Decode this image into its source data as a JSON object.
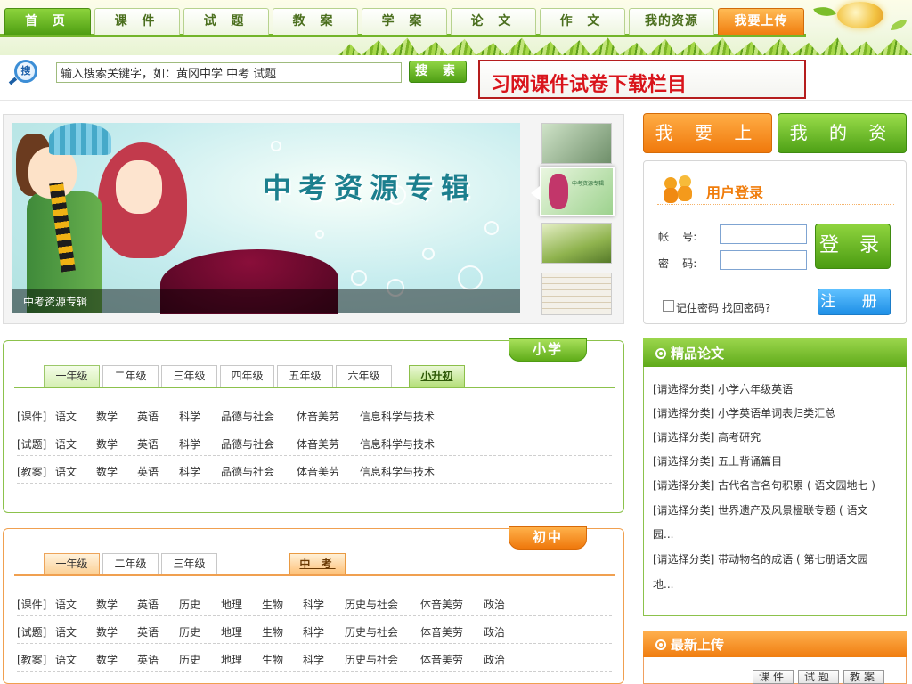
{
  "nav": {
    "items": [
      "首 页",
      "课 件",
      "试 题",
      "教 案",
      "学 案",
      "论 文",
      "作 文",
      "我的资源",
      "我要上传"
    ]
  },
  "search": {
    "icon_text": "搜",
    "value": "输入搜索关键字，如：黄冈中学 中考 试题",
    "button": "搜 索",
    "promo": "习网课件试卷下载栏目"
  },
  "banner": {
    "title": "中考资源专辑",
    "caption": "中考资源专辑",
    "thumb_labels": [
      "中考资源专辑"
    ]
  },
  "user": {
    "upload_label": "我 要 上 传",
    "myres_label": "我 的 资 源",
    "login_title": "用户登录",
    "account_label": "帐    号:",
    "password_label": "密    码:",
    "login_button": "登 录",
    "remember_label": "记住密码 找回密码?",
    "register_button": "注 册"
  },
  "primary": {
    "label": "小学",
    "grades": [
      "一年级",
      "二年级",
      "三年级",
      "四年级",
      "五年级",
      "六年级"
    ],
    "special_tab": "小升初",
    "rows": [
      {
        "type": "[课件]",
        "subjects": [
          "语文",
          "数学",
          "英语",
          "科学",
          "品德与社会",
          "体音美劳",
          "信息科学与技术"
        ]
      },
      {
        "type": "[试题]",
        "subjects": [
          "语文",
          "数学",
          "英语",
          "科学",
          "品德与社会",
          "体音美劳",
          "信息科学与技术"
        ]
      },
      {
        "type": "[教案]",
        "subjects": [
          "语文",
          "数学",
          "英语",
          "科学",
          "品德与社会",
          "体音美劳",
          "信息科学与技术"
        ]
      }
    ]
  },
  "junior": {
    "label": "初中",
    "grades": [
      "一年级",
      "二年级",
      "三年级"
    ],
    "special_tab": "中 考",
    "rows": [
      {
        "type": "[课件]",
        "subjects": [
          "语文",
          "数学",
          "英语",
          "历史",
          "地理",
          "生物",
          "科学",
          "历史与社会",
          "体音美劳",
          "政治"
        ]
      },
      {
        "type": "[试题]",
        "subjects": [
          "语文",
          "数学",
          "英语",
          "历史",
          "地理",
          "生物",
          "科学",
          "历史与社会",
          "体音美劳",
          "政治"
        ]
      },
      {
        "type": "[教案]",
        "subjects": [
          "语文",
          "数学",
          "英语",
          "历史",
          "地理",
          "生物",
          "科学",
          "历史与社会",
          "体音美劳",
          "政治"
        ]
      }
    ]
  },
  "papers": {
    "title": "精品论文",
    "items": [
      "[请选择分类] 小学六年级英语",
      "[请选择分类] 小学英语单词表归类汇总",
      "[请选择分类] 高考研究",
      "[请选择分类] 五上背诵篇目",
      "[请选择分类] 古代名言名句积累 ( 语文园地七 )",
      "[请选择分类] 世界遗产及风景楹联专题 ( 语文",
      "园...",
      "[请选择分类] 带动物名的成语 ( 第七册语文园",
      "地..."
    ]
  },
  "latest": {
    "title": "最新上传",
    "tabs": [
      "课件",
      "试题",
      "教案"
    ]
  },
  "colors": {
    "green": "#5faa1a",
    "orange": "#f07d10",
    "red_promo": "#d9141b",
    "blue_register": "#1e8fe6"
  }
}
